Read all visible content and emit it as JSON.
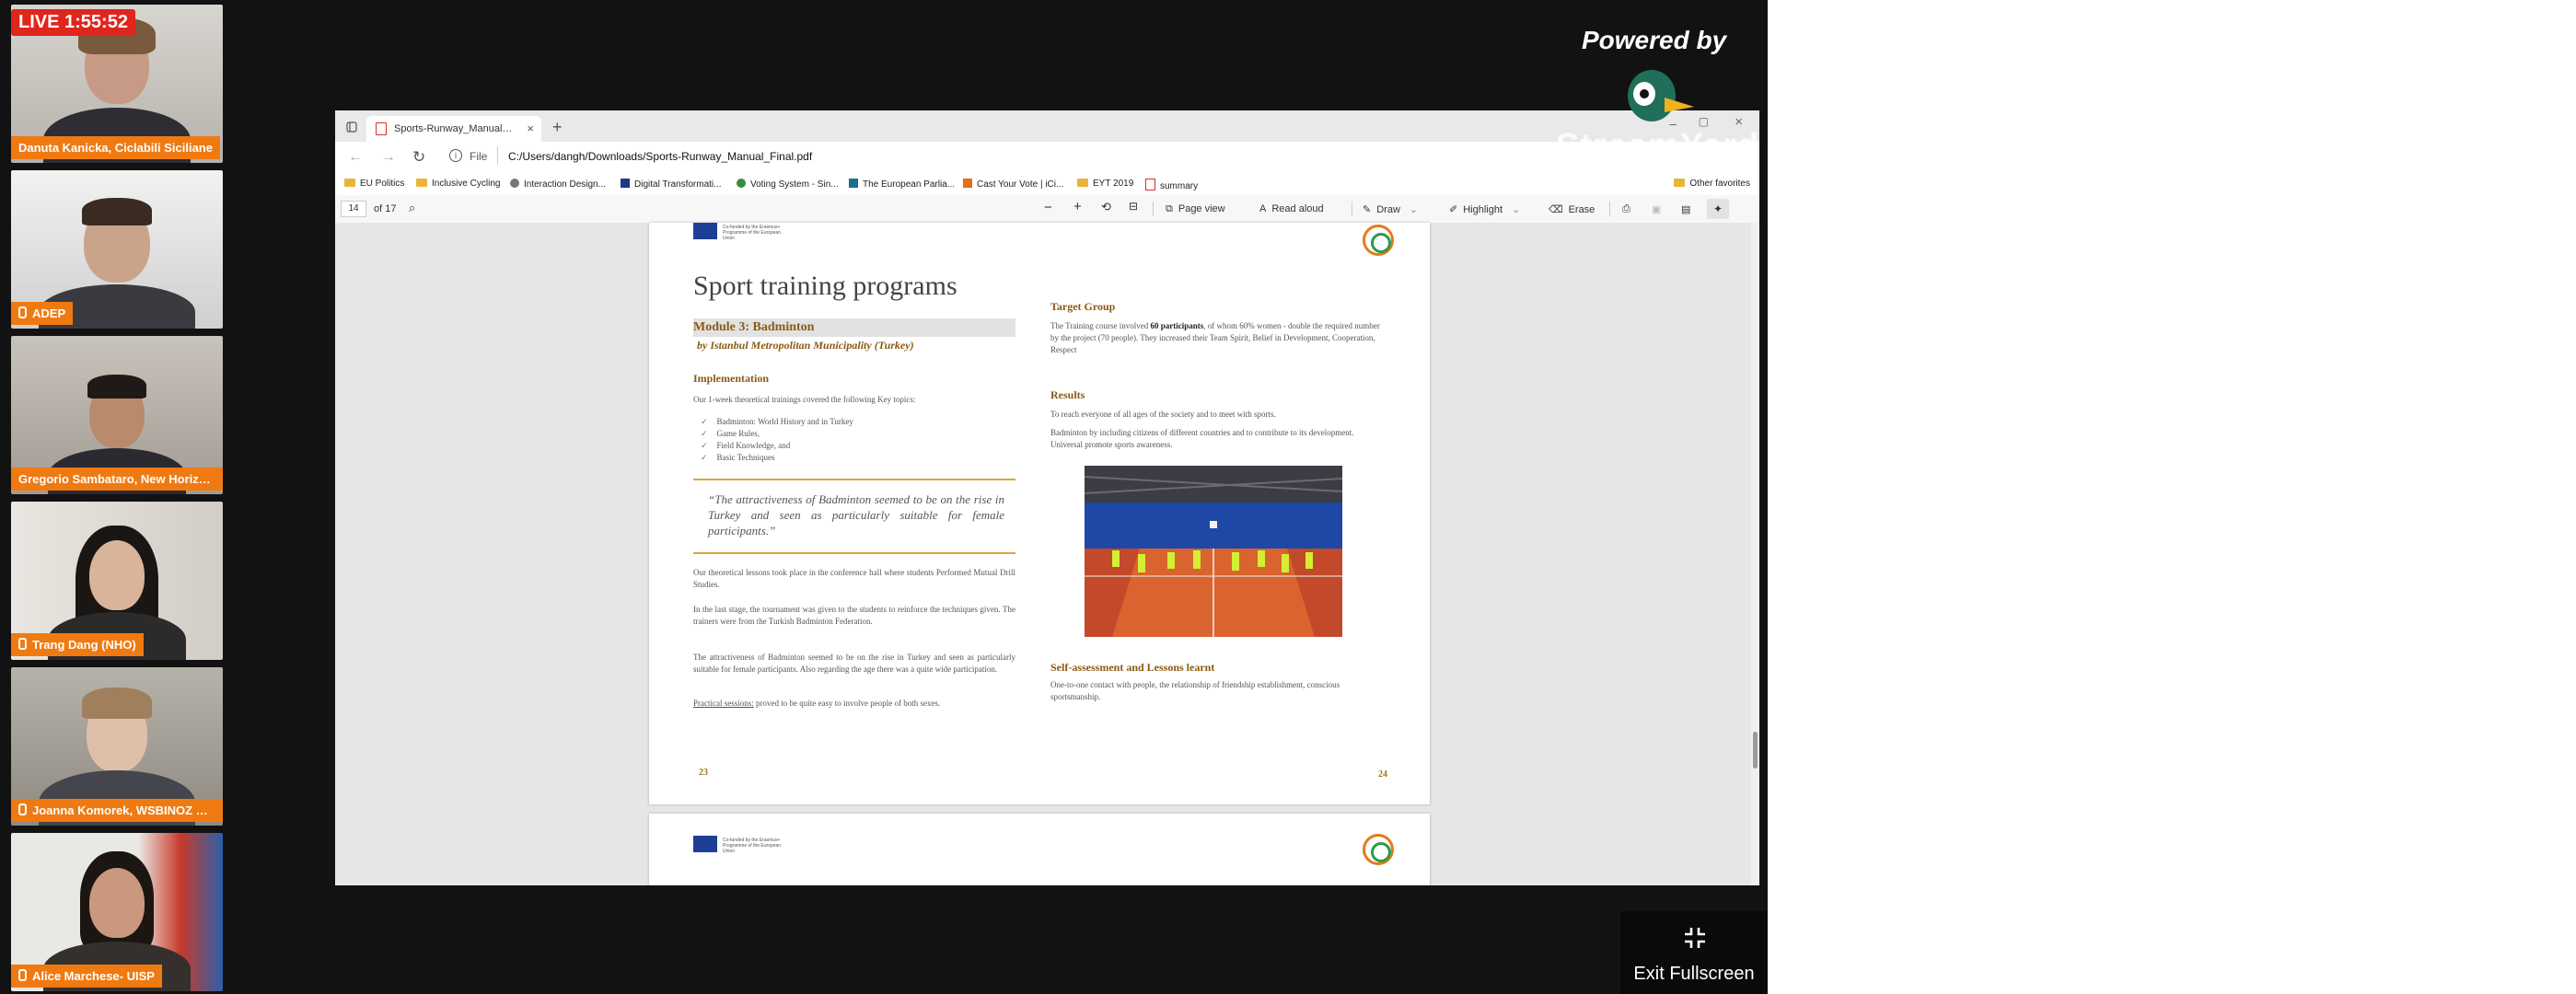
{
  "live": {
    "label": "LIVE 1:55:52"
  },
  "participants": [
    {
      "name": "Danuta Kanicka, Ciclabili Siciliane",
      "mic": false
    },
    {
      "name": "ADEP",
      "mic": true
    },
    {
      "name": "Gregorio Sambataro, New Horizo...",
      "mic": false
    },
    {
      "name": "Trang Dang (NHO)",
      "mic": true
    },
    {
      "name": "Joanna Komorek, WSBINOZ Po...",
      "mic": true
    },
    {
      "name": "Alice Marchese- UISP",
      "mic": true
    }
  ],
  "branding": {
    "powered_by": "Powered by",
    "logo_text": "StreamYard"
  },
  "exit": {
    "label": "Exit Fullscreen"
  },
  "browser": {
    "tab_title": "Sports-Runway_Manual_Final.pd",
    "url_scheme": "File",
    "url": "C:/Users/dangh/Downloads/Sports-Runway_Manual_Final.pdf",
    "favorites": [
      "EU Politics",
      "Inclusive Cycling",
      "Interaction Design...",
      "Digital Transformati...",
      "Voting System - Sin...",
      "The European Parlia...",
      "Cast Your Vote | iCi...",
      "EYT 2019",
      "summary"
    ],
    "other_favorites": "Other favorites"
  },
  "pdf_toolbar": {
    "page_current": "14",
    "page_total": "of 17",
    "page_view": "Page view",
    "read_aloud": "Read aloud",
    "draw": "Draw",
    "highlight": "Highlight",
    "erase": "Erase"
  },
  "doc": {
    "title": "Sport training programs",
    "eu_caption": "Co-funded by the Erasmus+ Programme of the European Union",
    "module": "Module 3: Badminton",
    "by": "by Istanbul Metropolitan Municipality (Turkey)",
    "impl_h": "Implementation",
    "impl_intro": "Our 1-week theoretical trainings covered the following Key topics:",
    "topics": [
      "Badminton: World History and in Turkey",
      "Game Rules,",
      "Field Knowledge, and",
      "Basic Techniques"
    ],
    "quote": "“The attractiveness of Badminton seemed to be on the rise in Turkey and seen as particularly suitable for female participants.”",
    "p1": "Our theoretical lessons took place in the conference hall where students Performed Mutual Drill Studies.",
    "p2": "In the last stage, the tournament was given to the students to reinforce the techniques given. The trainers were from the Turkish Badminton Federation.",
    "p3": "The attractiveness of Badminton seemed to be on the rise in Turkey and seen as particularly suitable for female participants. Also regarding the age there was a quite wide participation.",
    "p4_u": "Practical sessions:",
    "p4": " proved to be quite easy to involve people of both sexes.",
    "target_h": "Target Group",
    "target_a": "The Training course involved ",
    "target_b": "60 participants",
    "target_c": ", of whom 60% women - double the required number by the project (70 people). They increased their Team Spirit, Belief in Development, Cooperation, Respect",
    "results_h": "Results",
    "r1": "To reach everyone of all ages of the society and to meet with sports.",
    "r2": "Badminton by including citizens of different countries and to contribute to its development. Universal promote sports awareness.",
    "self_h": "Self-assessment and Lessons learnt",
    "self_t": "One-to-one contact with people, the relationship of friendship establishment, conscious sportsmanship.",
    "pn_left": "23",
    "pn_right": "24"
  }
}
